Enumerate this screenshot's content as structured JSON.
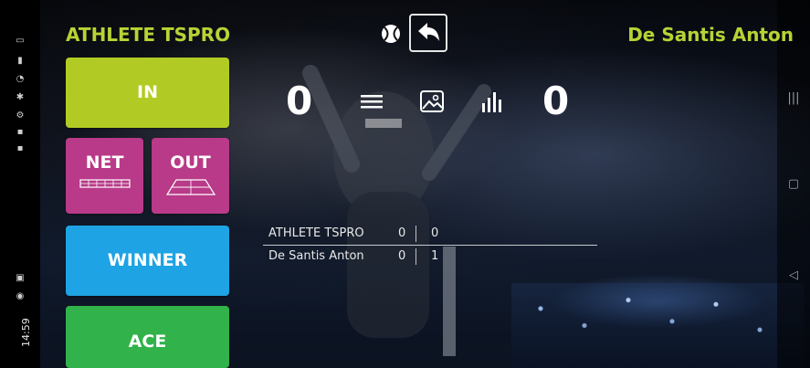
{
  "status_bar": {
    "time": "14:59"
  },
  "header": {
    "player1": "ATHLETE TSPRO",
    "player2": "De Santis Anton"
  },
  "actions": {
    "in": "IN",
    "net": "NET",
    "out": "OUT",
    "winner": "WINNER",
    "ace": "ACE"
  },
  "score": {
    "left": "0",
    "right": "0"
  },
  "table": {
    "rows": [
      {
        "name": "ATHLETE TSPRO",
        "c1": "0",
        "c2": "0"
      },
      {
        "name": "De Santis Anton",
        "c1": "0",
        "c2": "1"
      }
    ]
  },
  "colors": {
    "accent_text": "#b7d335",
    "in_button": "#b2cb24",
    "net_out_buttons": "#b83a88",
    "winner_button": "#1ea3e4",
    "ace_button": "#31b24a"
  },
  "icons": [
    "tennis-ball-icon",
    "undo-icon",
    "menu-icon",
    "image-icon",
    "stats-icon",
    "net-icon",
    "court-icon",
    "recents-icon",
    "home-icon",
    "back-icon"
  ]
}
